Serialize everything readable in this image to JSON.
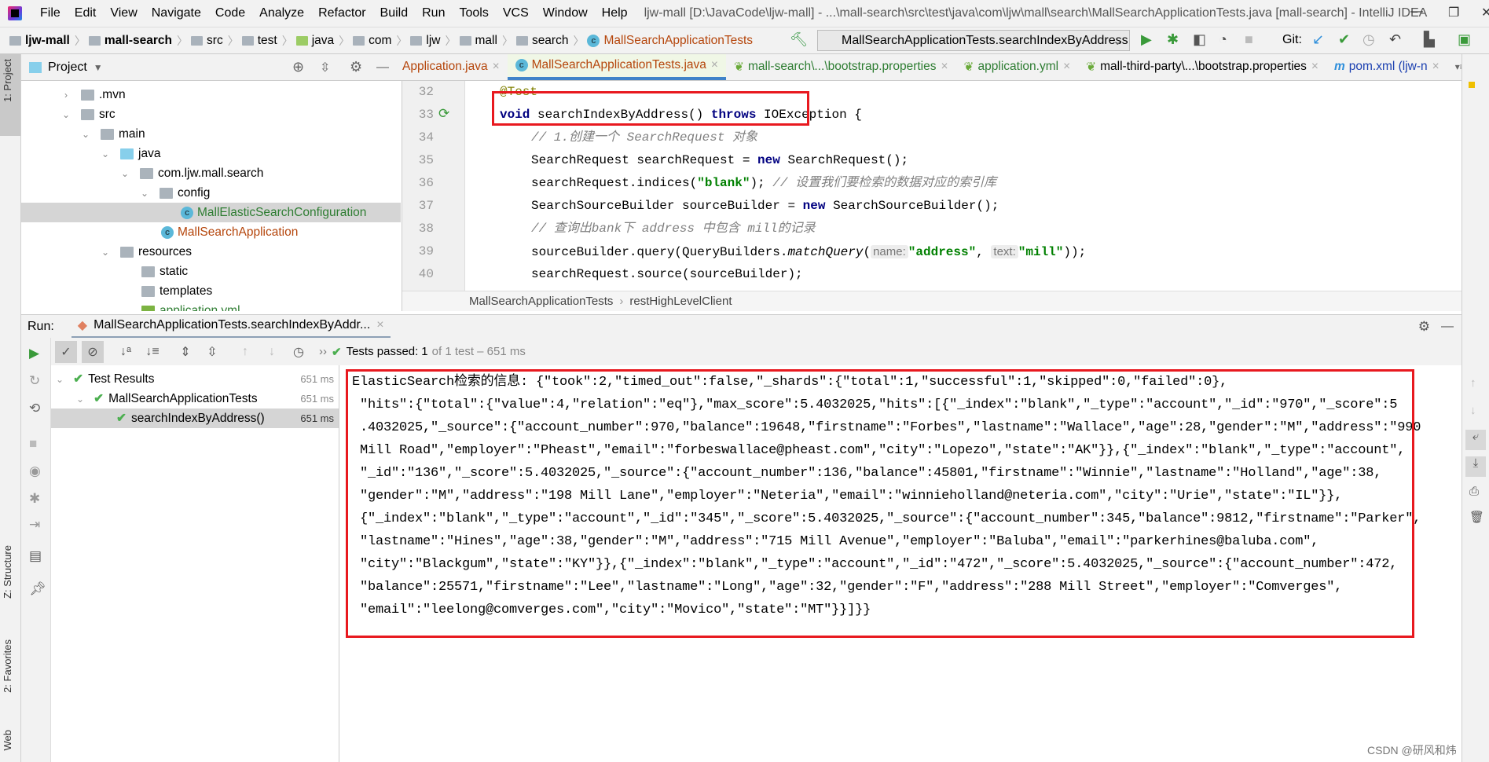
{
  "menu": {
    "items": [
      "File",
      "Edit",
      "View",
      "Navigate",
      "Code",
      "Analyze",
      "Refactor",
      "Build",
      "Run",
      "Tools",
      "VCS",
      "Window",
      "Help"
    ],
    "title": "ljw-mall [D:\\JavaCode\\ljw-mall] - ...\\mall-search\\src\\test\\java\\com\\ljw\\mall\\search\\MallSearchApplicationTests.java [mall-search] - IntelliJ IDEA"
  },
  "breadcrumb": [
    "ljw-mall",
    "mall-search",
    "src",
    "test",
    "java",
    "com",
    "ljw",
    "mall",
    "search",
    "MallSearchApplicationTests"
  ],
  "toolbar": {
    "run_config": "MallSearchApplicationTests.searchIndexByAddress",
    "git_label": "Git:"
  },
  "project": {
    "title": "Project",
    "tree": [
      ".mvn",
      "src",
      "main",
      "java",
      "com.ljw.mall.search",
      "config",
      "MallElasticSearchConfiguration",
      "MallSearchApplication",
      "resources",
      "static",
      "templates",
      "application.yml"
    ]
  },
  "editor": {
    "tabs": [
      "Application.java",
      "MallSearchApplicationTests.java",
      "mall-search\\...\\bootstrap.properties",
      "application.yml",
      "mall-third-party\\...\\bootstrap.properties",
      "pom.xml (ljw-n"
    ],
    "line_numbers": [
      "32",
      "33",
      "34",
      "35",
      "36",
      "37",
      "38",
      "39",
      "40"
    ],
    "code": {
      "l32": "@Test",
      "l33_kw1": "void",
      "l33_name": " searchIndexByAddress() ",
      "l33_kw2": "throws",
      "l33_rest": " IOException {",
      "l34": "// 1.创建一个 SearchRequest 对象",
      "l35_a": "SearchRequest searchRequest = ",
      "l35_kw": "new",
      "l35_b": " SearchRequest();",
      "l36_a": "searchRequest.indices(",
      "l36_str": "\"blank\"",
      "l36_b": "); ",
      "l36_cmt": "// 设置我们要检索的数据对应的索引库",
      "l37_a": "SearchSourceBuilder sourceBuilder = ",
      "l37_kw": "new",
      "l37_b": " SearchSourceBuilder();",
      "l38": "// 查询出bank下 address 中包含 mill的记录",
      "l39_a": "sourceBuilder.query(QueryBuilders.",
      "l39_method": "matchQuery",
      "l39_b": "(",
      "l39_hint1": "name:",
      "l39_str1": "\"address\"",
      "l39_c": ", ",
      "l39_hint2": "text:",
      "l39_str2": "\"mill\"",
      "l39_d": "));",
      "l40": "searchRequest.source(sourceBuilder);"
    },
    "crumb": [
      "MallSearchApplicationTests",
      "restHighLevelClient"
    ]
  },
  "run": {
    "label": "Run:",
    "tab": "MallSearchApplicationTests.searchIndexByAddr...",
    "status_prefix": "Tests passed:",
    "status_count": "1",
    "status_rest": "of 1 test – 651 ms",
    "tests": [
      {
        "name": "Test Results",
        "time": "651 ms"
      },
      {
        "name": "MallSearchApplicationTests",
        "time": "651 ms"
      },
      {
        "name": "searchIndexByAddress()",
        "time": "651 ms"
      }
    ],
    "output": [
      "ElasticSearch检索的信息: {\"took\":2,\"timed_out\":false,\"_shards\":{\"total\":1,\"successful\":1,\"skipped\":0,\"failed\":0},",
      " \"hits\":{\"total\":{\"value\":4,\"relation\":\"eq\"},\"max_score\":5.4032025,\"hits\":[{\"_index\":\"blank\",\"_type\":\"account\",\"_id\":\"970\",\"_score\":5",
      " .4032025,\"_source\":{\"account_number\":970,\"balance\":19648,\"firstname\":\"Forbes\",\"lastname\":\"Wallace\",\"age\":28,\"gender\":\"M\",\"address\":\"990",
      " Mill Road\",\"employer\":\"Pheast\",\"email\":\"forbeswallace@pheast.com\",\"city\":\"Lopezo\",\"state\":\"AK\"}},{\"_index\":\"blank\",\"_type\":\"account\",",
      " \"_id\":\"136\",\"_score\":5.4032025,\"_source\":{\"account_number\":136,\"balance\":45801,\"firstname\":\"Winnie\",\"lastname\":\"Holland\",\"age\":38,",
      " \"gender\":\"M\",\"address\":\"198 Mill Lane\",\"employer\":\"Neteria\",\"email\":\"winnieholland@neteria.com\",\"city\":\"Urie\",\"state\":\"IL\"}},",
      " {\"_index\":\"blank\",\"_type\":\"account\",\"_id\":\"345\",\"_score\":5.4032025,\"_source\":{\"account_number\":345,\"balance\":9812,\"firstname\":\"Parker\",",
      " \"lastname\":\"Hines\",\"age\":38,\"gender\":\"M\",\"address\":\"715 Mill Avenue\",\"employer\":\"Baluba\",\"email\":\"parkerhines@baluba.com\",",
      " \"city\":\"Blackgum\",\"state\":\"KY\"}},{\"_index\":\"blank\",\"_type\":\"account\",\"_id\":\"472\",\"_score\":5.4032025,\"_source\":{\"account_number\":472,",
      " \"balance\":25571,\"firstname\":\"Lee\",\"lastname\":\"Long\",\"age\":32,\"gender\":\"F\",\"address\":\"288 Mill Street\",\"employer\":\"Comverges\",",
      " \"email\":\"leelong@comverges.com\",\"city\":\"Movico\",\"state\":\"MT\"}}]}}"
    ]
  },
  "side_tabs": {
    "project": "1: Project",
    "structure": "Z: Structure",
    "favorites": "2: Favorites",
    "web": "Web"
  },
  "watermark": "CSDN @研风和炜",
  "colors": {
    "highlight_box": "#e8191f",
    "pass_green": "#4caf50",
    "active_tab_underline": "#4083c9"
  }
}
